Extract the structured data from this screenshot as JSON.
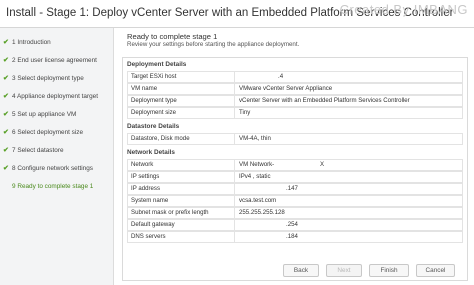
{
  "window": {
    "title": "Install - Stage 1: Deploy vCenter Server with an Embedded Platform Services Controller",
    "watermark": "Created By IMBANG"
  },
  "sidebar": {
    "steps": [
      {
        "check": "✔",
        "label": "1 Introduction"
      },
      {
        "check": "✔",
        "label": "2 End user license agreement"
      },
      {
        "check": "✔",
        "label": "3 Select deployment type"
      },
      {
        "check": "✔",
        "label": "4 Appliance deployment target"
      },
      {
        "check": "✔",
        "label": "5 Set up appliance VM"
      },
      {
        "check": "✔",
        "label": "6 Select deployment size"
      },
      {
        "check": "✔",
        "label": "7 Select datastore"
      },
      {
        "check": "✔",
        "label": "8 Configure network settings"
      },
      {
        "check": "",
        "label": "9 Ready to complete stage 1"
      }
    ]
  },
  "main": {
    "heading": "Ready to complete stage 1",
    "subheading": "Review your settings before starting the appliance deployment.",
    "sections": {
      "deployment": {
        "title": "Deployment Details",
        "rows": [
          {
            "k": "Target ESXi host",
            "v": ".4"
          },
          {
            "k": "VM name",
            "v": "VMware vCenter Server Appliance"
          },
          {
            "k": "Deployment type",
            "v": "vCenter Server with an Embedded Platform Services Controller"
          },
          {
            "k": "Deployment size",
            "v": "Tiny"
          }
        ]
      },
      "datastore": {
        "title": "Datastore Details",
        "rows": [
          {
            "k": "Datastore, Disk mode",
            "v": "VM-4A, thin"
          }
        ]
      },
      "network": {
        "title": "Network Details",
        "rows": [
          {
            "k": "Network",
            "v": "VM Network-",
            "v2": "X"
          },
          {
            "k": "IP settings",
            "v": "IPv4 , static"
          },
          {
            "k": "IP address",
            "v": ".147"
          },
          {
            "k": "System name",
            "v": "vcsa.test.com"
          },
          {
            "k": "Subnet mask or prefix length",
            "v": "255.255.255.128"
          },
          {
            "k": "Default gateway",
            "v": ".254"
          },
          {
            "k": "DNS servers",
            "v": ".184"
          }
        ]
      }
    }
  },
  "footer": {
    "back": "Back",
    "next": "Next",
    "finish": "Finish",
    "cancel": "Cancel"
  }
}
